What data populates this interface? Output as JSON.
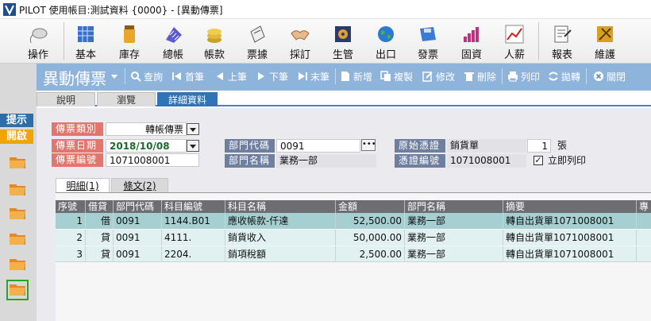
{
  "window": {
    "title": "PILOT  使用帳目:測試資料 {0000} - [異動傳票]"
  },
  "toolbar": [
    {
      "label": "操作",
      "icon": "mouse-icon"
    },
    {
      "label": "基本",
      "icon": "grid-icon"
    },
    {
      "label": "庫存",
      "icon": "jar-icon"
    },
    {
      "label": "總帳",
      "icon": "calculator-icon"
    },
    {
      "label": "帳款",
      "icon": "coins-icon"
    },
    {
      "label": "票據",
      "icon": "note-icon"
    },
    {
      "label": "採訂",
      "icon": "handshake-icon"
    },
    {
      "label": "生管",
      "icon": "gear-icon"
    },
    {
      "label": "出口",
      "icon": "globe-icon"
    },
    {
      "label": "發票",
      "icon": "disk-icon"
    },
    {
      "label": "固資",
      "icon": "bar-chart-icon"
    },
    {
      "label": "人薪",
      "icon": "line-chart-icon"
    },
    {
      "label": "報表",
      "icon": "report-icon"
    },
    {
      "label": "維護",
      "icon": "tools-icon"
    }
  ],
  "sidebar": {
    "hint": "提示",
    "open": "開啟"
  },
  "header": {
    "title": "異動傳票"
  },
  "actions": [
    {
      "label": "查詢",
      "icon": "search-icon"
    },
    {
      "label": "首筆",
      "icon": "first-icon"
    },
    {
      "label": "上筆",
      "icon": "prev-icon"
    },
    {
      "label": "下筆",
      "icon": "next-icon"
    },
    {
      "label": "末筆",
      "icon": "last-icon"
    },
    {
      "label": "新增",
      "icon": "new-icon"
    },
    {
      "label": "複製",
      "icon": "copy-icon"
    },
    {
      "label": "修改",
      "icon": "edit-icon"
    },
    {
      "label": "刪除",
      "icon": "delete-icon"
    },
    {
      "label": "列印",
      "icon": "print-icon"
    },
    {
      "label": "拋轉",
      "icon": "transfer-icon"
    },
    {
      "label": "關閉",
      "icon": "close-icon"
    }
  ],
  "tabs": {
    "explain": "說明",
    "browse": "瀏覽",
    "detail": "詳細資料"
  },
  "form": {
    "voucher_type": {
      "label": "傳票類別",
      "value": "轉帳傳票"
    },
    "voucher_date": {
      "label": "傳票日期",
      "value": "2018/10/08"
    },
    "voucher_no": {
      "label": "傳票編號",
      "value": "1071008001"
    },
    "dept_code": {
      "label": "部門代碼",
      "value": "0091"
    },
    "dept_name": {
      "label": "部門名稱",
      "value": "業務一部"
    },
    "source_doc": {
      "label": "原始憑證",
      "value": "銷貨單"
    },
    "source_count": "1",
    "source_unit": "張",
    "cert_no": {
      "label": "憑證編號",
      "value": "1071008001"
    },
    "print_now": {
      "label": "立即列印",
      "checked": true
    }
  },
  "subtabs": {
    "detail": "明細(1)",
    "memo": "條文(2)"
  },
  "grid": {
    "columns": [
      "序號",
      "借貸",
      "部門代碼",
      "科目編號",
      "科目名稱",
      "金額",
      "部門名稱",
      "摘要",
      "專"
    ],
    "rows": [
      [
        "1",
        "借",
        "0091",
        "1144.B01",
        "應收帳款-仟達",
        "52,500.00",
        "業務一部",
        "轉自出貨單1071008001"
      ],
      [
        "2",
        "貸",
        "0091",
        "4111.",
        "銷貨收入",
        "50,000.00",
        "業務一部",
        "轉自出貨單1071008001"
      ],
      [
        "3",
        "貸",
        "0091",
        "2204.",
        "銷項稅額",
        "2,500.00",
        "業務一部",
        "轉自出貨單1071008001"
      ]
    ]
  }
}
